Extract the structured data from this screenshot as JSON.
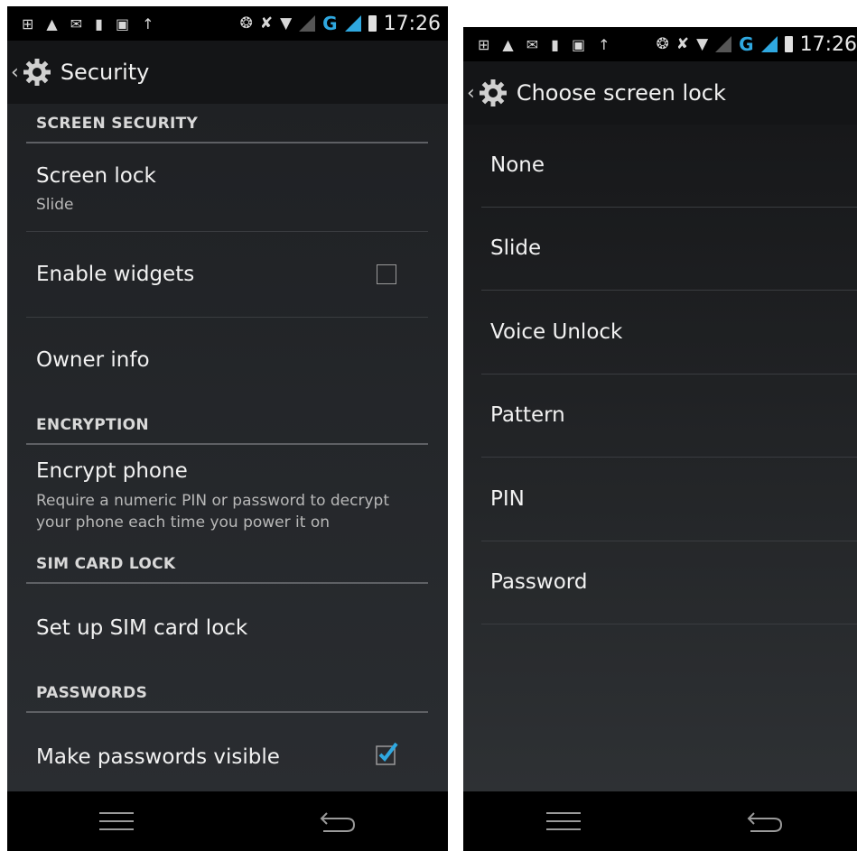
{
  "left": {
    "status": {
      "time": "17:26",
      "network_letter": "G"
    },
    "title": "Security",
    "sections": {
      "screen_security": "SCREEN SECURITY",
      "encryption": "ENCRYPTION",
      "sim_card_lock": "SIM CARD LOCK",
      "passwords": "PASSWORDS"
    },
    "items": {
      "screen_lock": {
        "title": "Screen lock",
        "summary": "Slide"
      },
      "enable_widgets": {
        "title": "Enable widgets",
        "checked": false
      },
      "owner_info": {
        "title": "Owner info"
      },
      "encrypt_phone": {
        "title": "Encrypt phone",
        "summary_line1": "Require a numeric PIN or password to decrypt",
        "summary_line2": "your phone each time you power it on"
      },
      "set_up_sim_lock": {
        "title": "Set up SIM card lock"
      },
      "make_passwords_visible": {
        "title": "Make passwords visible",
        "checked": true
      }
    }
  },
  "right": {
    "status": {
      "time": "17:26",
      "network_letter": "G"
    },
    "title": "Choose screen lock",
    "options": [
      "None",
      "Slide",
      "Voice Unlock",
      "Pattern",
      "PIN",
      "Password"
    ]
  },
  "colors": {
    "accent": "#2fa8e0",
    "background": "#1f2124",
    "actionbar": "#141517"
  },
  "icons": [
    "settings-gear-icon",
    "back-chevron-icon",
    "wifi-icon",
    "bluetooth-icon",
    "muted-icon",
    "battery-icon",
    "menu-icon",
    "back-icon"
  ]
}
